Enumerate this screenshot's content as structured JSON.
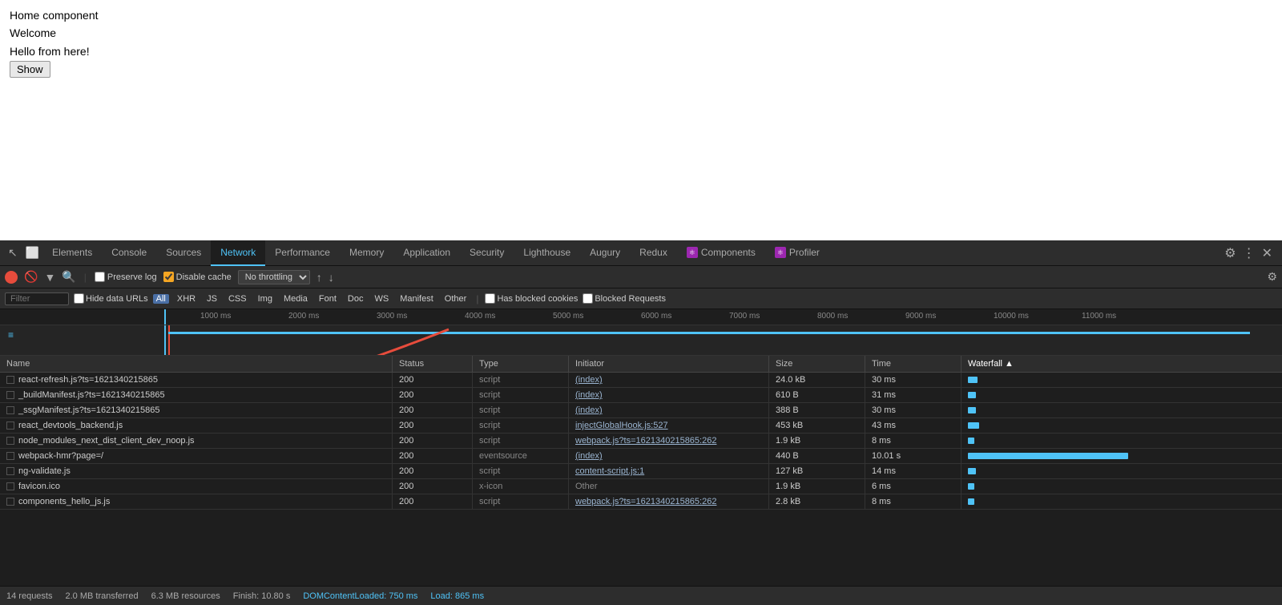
{
  "page": {
    "title": "Home component",
    "welcome": "Welcome",
    "hello": "Hello from here!",
    "show_button": "Show"
  },
  "devtools": {
    "tabs": [
      {
        "id": "elements",
        "label": "Elements",
        "active": false
      },
      {
        "id": "console",
        "label": "Console",
        "active": false
      },
      {
        "id": "sources",
        "label": "Sources",
        "active": false
      },
      {
        "id": "network",
        "label": "Network",
        "active": true
      },
      {
        "id": "performance",
        "label": "Performance",
        "active": false
      },
      {
        "id": "memory",
        "label": "Memory",
        "active": false
      },
      {
        "id": "application",
        "label": "Application",
        "active": false
      },
      {
        "id": "security",
        "label": "Security",
        "active": false
      },
      {
        "id": "lighthouse",
        "label": "Lighthouse",
        "active": false
      },
      {
        "id": "augury",
        "label": "Augury",
        "active": false
      },
      {
        "id": "redux",
        "label": "Redux",
        "active": false
      },
      {
        "id": "components",
        "label": "Components",
        "active": false,
        "has_icon": true
      },
      {
        "id": "profiler",
        "label": "Profiler",
        "active": false,
        "has_icon": true
      }
    ],
    "toolbar": {
      "preserve_log": "Preserve log",
      "disable_cache": "Disable cache",
      "throttle": "No throttling"
    },
    "filter_bar": {
      "placeholder": "Filter",
      "hide_data_urls": "Hide data URLs",
      "all_label": "All",
      "types": [
        "XHR",
        "JS",
        "CSS",
        "Img",
        "Media",
        "Font",
        "Doc",
        "WS",
        "Manifest",
        "Other"
      ],
      "has_blocked": "Has blocked cookies",
      "blocked_req": "Blocked Requests"
    },
    "timeline": {
      "ticks": [
        "1000 ms",
        "2000 ms",
        "3000 ms",
        "4000 ms",
        "5000 ms",
        "6000 ms",
        "7000 ms",
        "8000 ms",
        "9000 ms",
        "10000 ms",
        "11000 ms"
      ]
    },
    "table": {
      "headers": [
        "Name",
        "Status",
        "Type",
        "Initiator",
        "Size",
        "Time",
        "Waterfall"
      ],
      "rows": [
        {
          "name": "react-refresh.js?ts=1621340215865",
          "status": "200",
          "type": "script",
          "initiator": "(index)",
          "size": "24.0 kB",
          "time": "30 ms",
          "waterfall_color": "blue",
          "waterfall_width": 12
        },
        {
          "name": "_buildManifest.js?ts=1621340215865",
          "status": "200",
          "type": "script",
          "initiator": "(index)",
          "size": "610 B",
          "time": "31 ms",
          "waterfall_color": "blue",
          "waterfall_width": 10
        },
        {
          "name": "_ssgManifest.js?ts=1621340215865",
          "status": "200",
          "type": "script",
          "initiator": "(index)",
          "size": "388 B",
          "time": "30 ms",
          "waterfall_color": "blue",
          "waterfall_width": 10
        },
        {
          "name": "react_devtools_backend.js",
          "status": "200",
          "type": "script",
          "initiator": "injectGlobalHook.js:527",
          "size": "453 kB",
          "time": "43 ms",
          "waterfall_color": "blue",
          "waterfall_width": 14
        },
        {
          "name": "node_modules_next_dist_client_dev_noop.js",
          "status": "200",
          "type": "script",
          "initiator": "webpack.js?ts=1621340215865:262",
          "size": "1.9 kB",
          "time": "8 ms",
          "waterfall_color": "blue",
          "waterfall_width": 8
        },
        {
          "name": "webpack-hmr?page=/",
          "status": "200",
          "type": "eventsource",
          "initiator": "(index)",
          "size": "440 B",
          "time": "10.01 s",
          "waterfall_color": "blue_long",
          "waterfall_width": 200
        },
        {
          "name": "ng-validate.js",
          "status": "200",
          "type": "script",
          "initiator": "content-script.js:1",
          "size": "127 kB",
          "time": "14 ms",
          "waterfall_color": "blue",
          "waterfall_width": 10
        },
        {
          "name": "favicon.ico",
          "status": "200",
          "type": "x-icon",
          "initiator": "Other",
          "size": "1.9 kB",
          "time": "6 ms",
          "waterfall_color": "blue",
          "waterfall_width": 8
        },
        {
          "name": "components_hello_js.js",
          "status": "200",
          "type": "script",
          "initiator": "webpack.js?ts=1621340215865:262",
          "size": "2.8 kB",
          "time": "8 ms",
          "waterfall_color": "blue",
          "waterfall_width": 8
        }
      ]
    },
    "status_bar": {
      "requests": "14 requests",
      "transferred": "2.0 MB transferred",
      "resources": "6.3 MB resources",
      "finish": "Finish: 10.80 s",
      "dom_loaded": "DOMContentLoaded: 750 ms",
      "load": "Load: 865 ms"
    }
  }
}
